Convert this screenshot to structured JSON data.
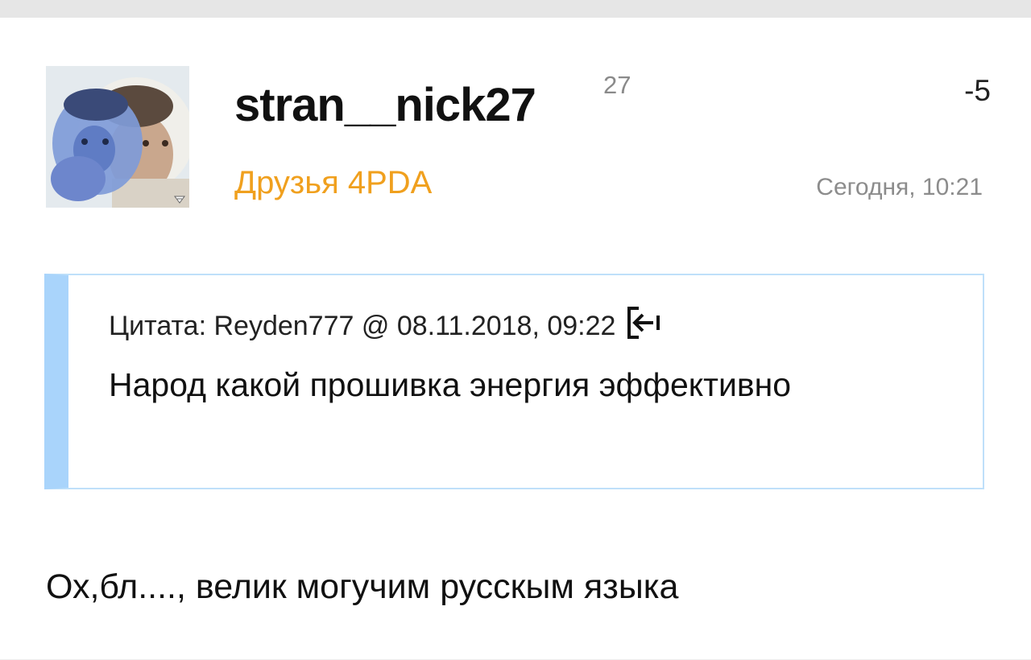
{
  "post": {
    "author": {
      "username": "stran__nick27",
      "reputation": "27",
      "group": "Друзья 4PDA",
      "group_color": "#f0a01e"
    },
    "rating": "-5",
    "time": "Сегодня, 10:21",
    "quote": {
      "header": "Цитата: Reyden777 @ 08.11.2018, 09:22",
      "text": "Народ какой прошивка энергия эффективно",
      "accent_color": "#a9d4fb",
      "link_icon": "arrow-to-source-icon"
    },
    "body": "Ох,бл...., велик могучим русскым языка"
  }
}
